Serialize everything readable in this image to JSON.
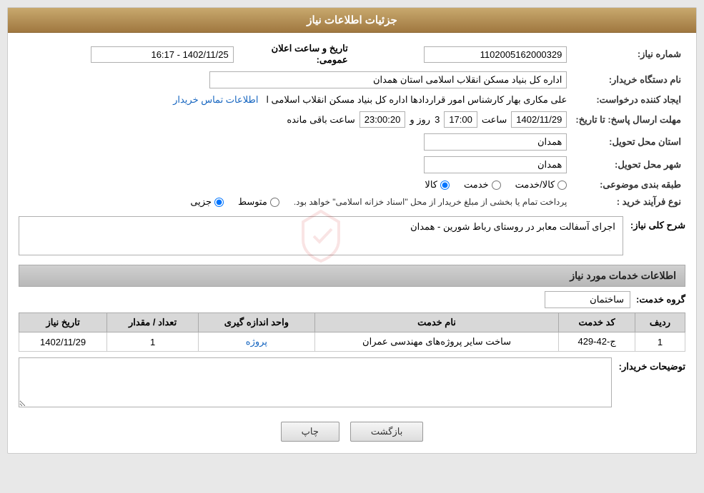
{
  "header": {
    "title": "جزئیات اطلاعات نیاز"
  },
  "fields": {
    "need_number_label": "شماره نیاز:",
    "need_number_value": "1102005162000329",
    "buyer_org_label": "نام دستگاه خریدار:",
    "buyer_org_value": "اداره کل بنیاد مسکن انقلاب اسلامی استان همدان",
    "creator_label": "ایجاد کننده درخواست:",
    "creator_value": "علی مکاری بهار کارشناس امور قراردادها اداره کل بنیاد مسکن انقلاب اسلامی ا",
    "creator_link": "اطلاعات تماس خریدار",
    "deadline_label": "مهلت ارسال پاسخ: تا تاریخ:",
    "deadline_date": "1402/11/29",
    "deadline_time_label": "ساعت",
    "deadline_time": "17:00",
    "deadline_day_label": "روز و",
    "deadline_days": "3",
    "remaining_label": "ساعت باقی مانده",
    "remaining_time": "23:00:20",
    "province_label": "استان محل تحویل:",
    "province_value": "همدان",
    "city_label": "شهر محل تحویل:",
    "city_value": "همدان",
    "category_label": "طبقه بندی موضوعی:",
    "cat_goods": "کالا",
    "cat_service": "خدمت",
    "cat_goods_service": "کالا/خدمت",
    "purchase_type_label": "نوع فرآیند خرید :",
    "purchase_partial": "جزیی",
    "purchase_medium": "متوسط",
    "purchase_note": "پرداخت تمام یا بخشی از مبلغ خریدار از محل \"اسناد خزانه اسلامی\" خواهد بود.",
    "announcement_date_label": "تاریخ و ساعت اعلان عمومی:",
    "announcement_date_value": "1402/11/25 - 16:17",
    "narration_label": "شرح کلی نیاز:",
    "narration_value": "اجرای آسفالت معابر در روستای رباط شورین - همدان",
    "services_section_label": "اطلاعات خدمات مورد نیاز",
    "group_label": "گروه خدمت:",
    "group_value": "ساختمان",
    "table_headers": {
      "row_num": "ردیف",
      "service_code": "کد خدمت",
      "service_name": "نام خدمت",
      "unit": "واحد اندازه گیری",
      "quantity": "تعداد / مقدار",
      "need_date": "تاریخ نیاز"
    },
    "table_rows": [
      {
        "row_num": "1",
        "service_code": "ج-42-429",
        "service_name": "ساخت سایر پروژه‌های مهندسی عمران",
        "unit": "پروژه",
        "quantity": "1",
        "need_date": "1402/11/29"
      }
    ],
    "buyer_desc_label": "توضیحات خریدار:",
    "buyer_desc_value": "",
    "btn_print": "چاپ",
    "btn_back": "بازگشت"
  }
}
